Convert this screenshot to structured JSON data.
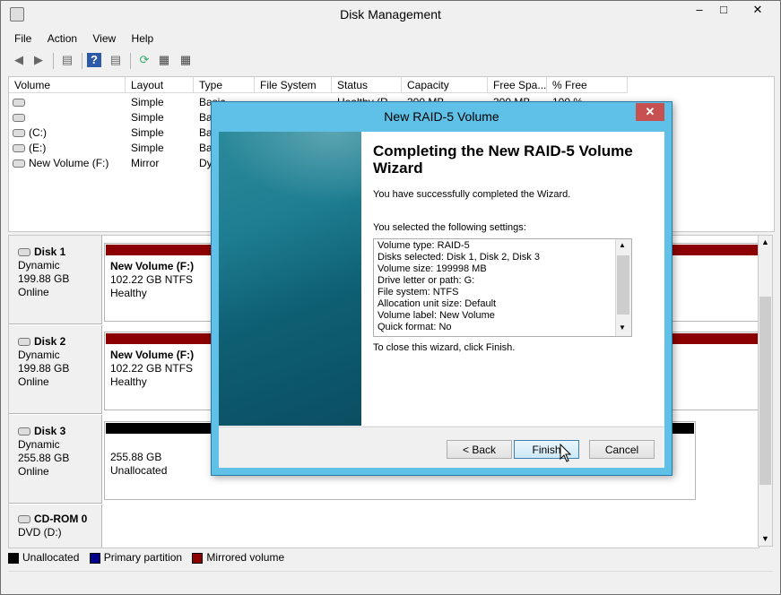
{
  "window": {
    "title": "Disk Management",
    "controls": {
      "minimize": "–",
      "maximize": "□",
      "close": "✕"
    }
  },
  "menu": [
    "File",
    "Action",
    "View",
    "Help"
  ],
  "toolbar_icons": [
    "back-icon",
    "forward-icon",
    "show-hide-console-tree-icon",
    "help-icon",
    "properties-icon",
    "refresh-icon",
    "rescan-disks-icon",
    "settings-icon"
  ],
  "volume_list": {
    "columns": [
      "Volume",
      "Layout",
      "Type",
      "File System",
      "Status",
      "Capacity",
      "Free Spa...",
      "% Free"
    ],
    "rows": [
      {
        "volume": "",
        "layout": "Simple",
        "type": "Basic",
        "fs": "",
        "status": "Healthy (R...",
        "capacity": "300 MB",
        "free": "300 MB",
        "pct": "100 %"
      },
      {
        "volume": "",
        "layout": "Simple",
        "type": "Basic",
        "fs": "",
        "status": "",
        "capacity": "",
        "free": "",
        "pct": ""
      },
      {
        "volume": "(C:)",
        "layout": "Simple",
        "type": "Basic",
        "fs": "",
        "status": "",
        "capacity": "",
        "free": "",
        "pct": ""
      },
      {
        "volume": "(E:)",
        "layout": "Simple",
        "type": "Basic",
        "fs": "",
        "status": "",
        "capacity": "",
        "free": "",
        "pct": ""
      },
      {
        "volume": "New Volume (F:)",
        "layout": "Mirror",
        "type": "Dynamic",
        "fs": "",
        "status": "",
        "capacity": "",
        "free": "",
        "pct": ""
      }
    ]
  },
  "disks": [
    {
      "name": "Disk 1",
      "type": "Dynamic",
      "size": "199.88 GB",
      "state": "Online",
      "partition": {
        "name": "New Volume  (F:)",
        "size": "102.22 GB NTFS",
        "status": "Healthy",
        "color": "#8b0000"
      }
    },
    {
      "name": "Disk 2",
      "type": "Dynamic",
      "size": "199.88 GB",
      "state": "Online",
      "partition": {
        "name": "New Volume  (F:)",
        "size": "102.22 GB NTFS",
        "status": "Healthy",
        "color": "#8b0000"
      }
    },
    {
      "name": "Disk 3",
      "type": "Dynamic",
      "size": "255.88 GB",
      "state": "Online",
      "partition": {
        "name": "",
        "size": "255.88 GB",
        "status": "Unallocated",
        "color": "#000000"
      }
    },
    {
      "name": "CD-ROM 0",
      "type": "DVD (D:)",
      "size": "",
      "state": ""
    }
  ],
  "legend": [
    {
      "label": "Unallocated",
      "color": "#000000"
    },
    {
      "label": "Primary partition",
      "color": "#00008b"
    },
    {
      "label": "Mirrored volume",
      "color": "#8b0000"
    }
  ],
  "dialog": {
    "title": "New RAID-5 Volume",
    "close": "✕",
    "heading": "Completing the New RAID-5 Volume Wizard",
    "success": "You have successfully completed the Wizard.",
    "selected_label": "You selected the following settings:",
    "settings": [
      "Volume type: RAID-5",
      "Disks selected: Disk 1, Disk 2, Disk 3",
      "Volume size: 199998 MB",
      "Drive letter or path: G:",
      "File system: NTFS",
      "Allocation unit size: Default",
      "Volume label: New Volume",
      "Quick format: No"
    ],
    "close_hint": "To close this wizard, click Finish.",
    "buttons": {
      "back": "< Back",
      "finish": "Finish",
      "cancel": "Cancel"
    }
  }
}
